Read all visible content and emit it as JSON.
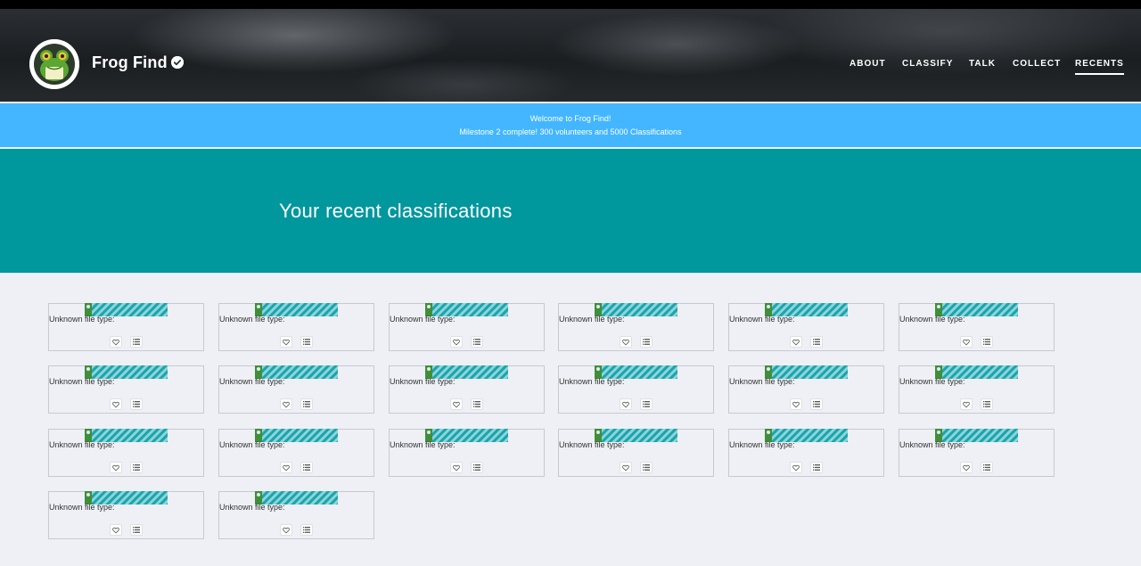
{
  "header": {
    "project_title": "Frog Find",
    "nav": [
      {
        "label": "ABOUT"
      },
      {
        "label": "CLASSIFY"
      },
      {
        "label": "TALK"
      },
      {
        "label": "COLLECT"
      },
      {
        "label": "RECENTS",
        "active": true
      }
    ]
  },
  "announcement": {
    "line1": "Welcome to Frog Find!",
    "line2": "Milestone 2 complete! 300 volunteers and 5000 Classifications"
  },
  "hero": {
    "title": "Your recent classifications"
  },
  "recents": {
    "unknown_label": "Unknown file type:",
    "items": [
      {
        "label": "Unknown file type:"
      },
      {
        "label": "Unknown file type:"
      },
      {
        "label": "Unknown file type:"
      },
      {
        "label": "Unknown file type:"
      },
      {
        "label": "Unknown file type:"
      },
      {
        "label": "Unknown file type:"
      },
      {
        "label": "Unknown file type:"
      },
      {
        "label": "Unknown file type:"
      },
      {
        "label": "Unknown file type:"
      },
      {
        "label": "Unknown file type:"
      },
      {
        "label": "Unknown file type:"
      },
      {
        "label": "Unknown file type:"
      },
      {
        "label": "Unknown file type:"
      },
      {
        "label": "Unknown file type:"
      },
      {
        "label": "Unknown file type:"
      },
      {
        "label": "Unknown file type:"
      },
      {
        "label": "Unknown file type:"
      },
      {
        "label": "Unknown file type:"
      },
      {
        "label": "Unknown file type:"
      },
      {
        "label": "Unknown file type:"
      }
    ]
  },
  "colors": {
    "announcement_bg": "#43b6ff",
    "hero_bg": "#00979d",
    "page_bg": "#eef0f5",
    "frog_green": "#5aa832"
  },
  "icons": [
    "frog-logo-icon",
    "verified-badge-icon",
    "broken-image-icon",
    "heart-icon",
    "collection-list-icon"
  ]
}
